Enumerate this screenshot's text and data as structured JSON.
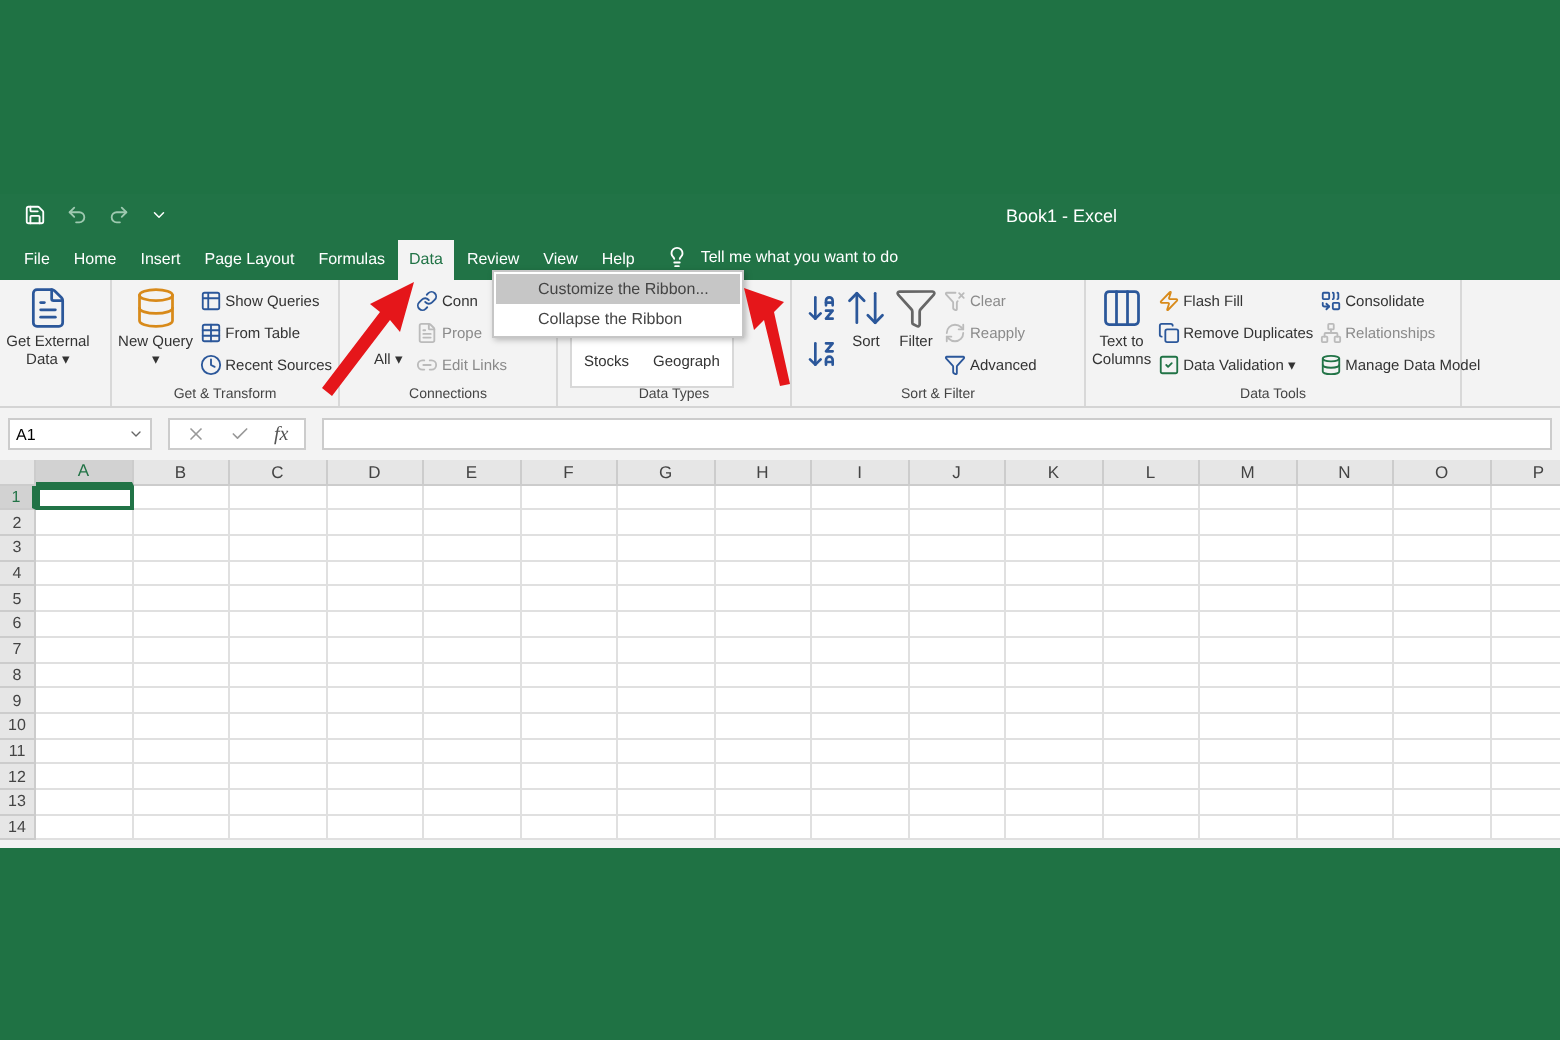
{
  "window": {
    "title": "Book1  -  Excel"
  },
  "tabs": [
    {
      "label": "File",
      "selected": false
    },
    {
      "label": "Home",
      "selected": false
    },
    {
      "label": "Insert",
      "selected": false
    },
    {
      "label": "Page Layout",
      "selected": false
    },
    {
      "label": "Formulas",
      "selected": false
    },
    {
      "label": "Data",
      "selected": true
    },
    {
      "label": "Review",
      "selected": false
    },
    {
      "label": "View",
      "selected": false
    },
    {
      "label": "Help",
      "selected": false
    }
  ],
  "tell_me": "Tell me what you want to do",
  "ribbon_groups": [
    {
      "columns": [
        [
          {
            "kind": "large",
            "label": "Get External Data ▾",
            "disabled": false
          }
        ]
      ]
    },
    {
      "label": "Get & Transform",
      "columns": [
        [
          {
            "kind": "large",
            "label": "New Query ▾",
            "disabled": false
          }
        ],
        [
          {
            "kind": "small",
            "label": "Show Queries",
            "disabled": false
          },
          {
            "kind": "small",
            "label": "From Table",
            "disabled": false
          },
          {
            "kind": "small",
            "label": "Recent Sources",
            "disabled": false
          }
        ]
      ]
    },
    {
      "label": "Connections",
      "columns": [
        [
          {
            "kind": "large_covered",
            "label": "All ▾",
            "disabled": false
          }
        ],
        [
          {
            "kind": "small",
            "label": "Conn",
            "disabled": false
          },
          {
            "kind": "small",
            "label": "Prope",
            "disabled": true
          },
          {
            "kind": "small",
            "label": "Edit Links",
            "disabled": true
          }
        ]
      ]
    },
    {
      "label": "Data Types",
      "columns": [
        [
          {
            "kind": "gallery",
            "label": "Stocks"
          },
          {
            "kind": "gallery",
            "label": "Geograph"
          }
        ]
      ]
    },
    {
      "label": "Sort & Filter",
      "columns": [
        [
          {
            "kind": "icon",
            "disabled": false
          },
          {
            "kind": "icon",
            "disabled": false
          }
        ],
        [
          {
            "kind": "large",
            "label": "Sort",
            "disabled": false
          }
        ],
        [
          {
            "kind": "large",
            "label": "Filter",
            "disabled": false
          }
        ],
        [
          {
            "kind": "small",
            "label": "Clear",
            "disabled": true
          },
          {
            "kind": "small",
            "label": "Reapply",
            "disabled": true
          },
          {
            "kind": "small",
            "label": "Advanced",
            "disabled": false
          }
        ]
      ]
    },
    {
      "label": "Data Tools",
      "columns": [
        [
          {
            "kind": "large",
            "label": "Text to Columns",
            "disabled": false
          }
        ],
        [
          {
            "kind": "small",
            "label": "Flash Fill",
            "disabled": false
          },
          {
            "kind": "small",
            "label": "Remove Duplicates",
            "disabled": false
          },
          {
            "kind": "small",
            "label": "Data Validation  ▾",
            "disabled": false
          }
        ],
        [
          {
            "kind": "small",
            "label": "Consolidate",
            "disabled": false
          },
          {
            "kind": "small",
            "label": "Relationships",
            "disabled": true
          },
          {
            "kind": "small",
            "label": "Manage Data Model",
            "disabled": false
          }
        ]
      ]
    }
  ],
  "context_menu": [
    {
      "label": "Customize the Ribbon...",
      "selected": true
    },
    {
      "label": "Collapse the Ribbon",
      "selected": false
    }
  ],
  "formula_bar": {
    "name_box": "A1",
    "function_label": "fx"
  },
  "columns": [
    {
      "label": "A",
      "selected": true
    },
    {
      "label": "B",
      "selected": false
    },
    {
      "label": "C",
      "selected": false
    },
    {
      "label": "D",
      "selected": false
    },
    {
      "label": "E",
      "selected": false
    },
    {
      "label": "F",
      "selected": false
    },
    {
      "label": "G",
      "selected": false
    },
    {
      "label": "H",
      "selected": false
    },
    {
      "label": "I",
      "selected": false
    },
    {
      "label": "J",
      "selected": false
    },
    {
      "label": "K",
      "selected": false
    },
    {
      "label": "L",
      "selected": false
    },
    {
      "label": "M",
      "selected": false
    },
    {
      "label": "N",
      "selected": false
    },
    {
      "label": "O",
      "selected": false
    },
    {
      "label": "P",
      "selected": false
    }
  ],
  "rows": [
    {
      "label": "1",
      "selected": true
    },
    {
      "label": "2",
      "selected": false
    },
    {
      "label": "3",
      "selected": false
    },
    {
      "label": "4",
      "selected": false
    },
    {
      "label": "5",
      "selected": false
    },
    {
      "label": "6",
      "selected": false
    },
    {
      "label": "7",
      "selected": false
    },
    {
      "label": "8",
      "selected": false
    },
    {
      "label": "9",
      "selected": false
    },
    {
      "label": "10",
      "selected": false
    },
    {
      "label": "11",
      "selected": false
    },
    {
      "label": "12",
      "selected": false
    },
    {
      "label": "13",
      "selected": false
    },
    {
      "label": "14",
      "selected": false
    }
  ]
}
